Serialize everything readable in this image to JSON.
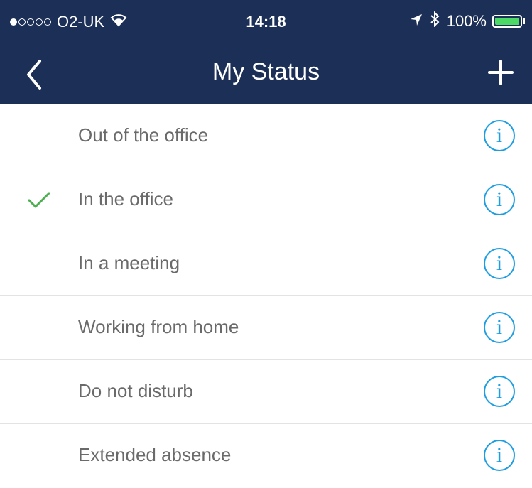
{
  "status_bar": {
    "carrier": "O2-UK",
    "time": "14:18",
    "battery": "100%"
  },
  "nav": {
    "title": "My Status"
  },
  "statuses": [
    {
      "label": "Out of the office",
      "selected": false
    },
    {
      "label": "In the office",
      "selected": true
    },
    {
      "label": "In a meeting",
      "selected": false
    },
    {
      "label": "Working from home",
      "selected": false
    },
    {
      "label": "Do not disturb",
      "selected": false
    },
    {
      "label": "Extended absence",
      "selected": false
    }
  ],
  "colors": {
    "header": "#1c2f57",
    "accent": "#1e9ee0",
    "check": "#4cb050"
  },
  "icons": {
    "info": "i"
  }
}
